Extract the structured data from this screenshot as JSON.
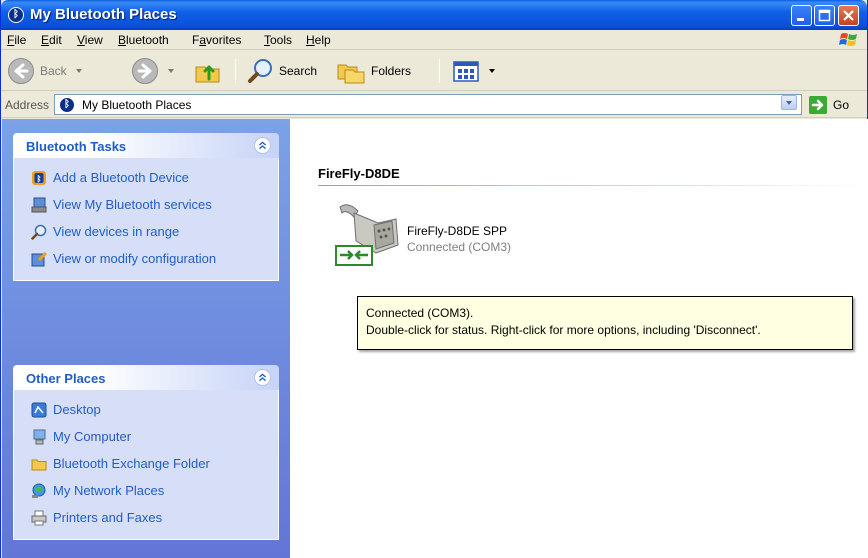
{
  "window": {
    "title": "My Bluetooth Places"
  },
  "menu": [
    {
      "label": "File",
      "accel": "F",
      "rest": "ile"
    },
    {
      "label": "Edit",
      "accel": "E",
      "rest": "dit"
    },
    {
      "label": "View",
      "accel": "V",
      "rest": "iew"
    },
    {
      "label": "Bluetooth",
      "accel": "B",
      "rest": "luetooth"
    },
    {
      "label": "Favorites",
      "pre": "F",
      "accel": "a",
      "rest": "vorites"
    },
    {
      "label": "Tools",
      "accel": "T",
      "rest": "ools"
    },
    {
      "label": "Help",
      "accel": "H",
      "rest": "elp"
    }
  ],
  "toolbar": {
    "back": "Back",
    "search": "Search",
    "folders": "Folders"
  },
  "address": {
    "label": "Address",
    "value": "My Bluetooth Places",
    "go": "Go"
  },
  "bluetooth_tasks": {
    "title": "Bluetooth Tasks",
    "items": [
      "Add a Bluetooth Device",
      "View My Bluetooth services",
      "View devices in range",
      "View or modify configuration"
    ]
  },
  "other_places": {
    "title": "Other Places",
    "items": [
      "Desktop",
      "My Computer",
      "Bluetooth Exchange Folder",
      "My Network Places",
      "Printers and Faxes"
    ]
  },
  "content": {
    "group_title": "FireFly-D8DE",
    "device_name": "FireFly-D8DE SPP",
    "device_status": "Connected (COM3)"
  },
  "tooltip": {
    "line1": "Connected (COM3).",
    "line2": "Double-click for status. Right-click for more options, including 'Disconnect'."
  },
  "colors": {
    "titlebar": "#0A5FE0",
    "taskpane": "#6375D6",
    "link": "#215DC6",
    "tooltip_bg": "#FFFFE1"
  }
}
